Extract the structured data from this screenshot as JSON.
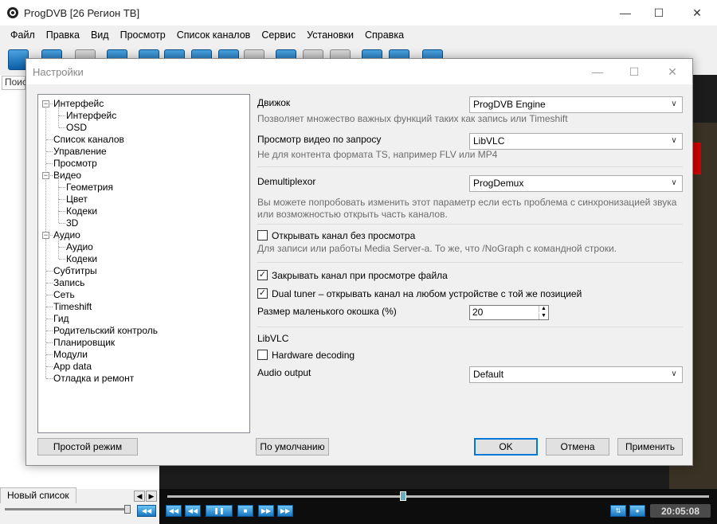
{
  "app": {
    "title": "ProgDVB [26 Регион ТВ]",
    "menu": [
      "Файл",
      "Правка",
      "Вид",
      "Просмотр",
      "Список каналов",
      "Сервис",
      "Установки",
      "Справка"
    ],
    "search_label": "Поис",
    "list_tab": "Новый список",
    "clock": "20:05:08"
  },
  "dialog": {
    "title": "Настройки",
    "tree": [
      {
        "label": "Интерфейс",
        "level": 0,
        "toggle": "-"
      },
      {
        "label": "Интерфейс",
        "level": 1
      },
      {
        "label": "OSD",
        "level": 1
      },
      {
        "label": "Список каналов",
        "level": 0
      },
      {
        "label": "Управление",
        "level": 0
      },
      {
        "label": "Просмотр",
        "level": 0
      },
      {
        "label": "Видео",
        "level": 0,
        "toggle": "-"
      },
      {
        "label": "Геометрия",
        "level": 1
      },
      {
        "label": "Цвет",
        "level": 1
      },
      {
        "label": "Кодеки",
        "level": 1
      },
      {
        "label": "3D",
        "level": 1
      },
      {
        "label": "Аудио",
        "level": 0,
        "toggle": "-"
      },
      {
        "label": "Аудио",
        "level": 1
      },
      {
        "label": "Кодеки",
        "level": 1
      },
      {
        "label": "Субтитры",
        "level": 0
      },
      {
        "label": "Запись",
        "level": 0
      },
      {
        "label": "Сеть",
        "level": 0
      },
      {
        "label": "Timeshift",
        "level": 0
      },
      {
        "label": "Гид",
        "level": 0
      },
      {
        "label": "Родительский контроль",
        "level": 0
      },
      {
        "label": "Планировщик",
        "level": 0
      },
      {
        "label": "Модули",
        "level": 0
      },
      {
        "label": "App data",
        "level": 0
      },
      {
        "label": "Отладка и ремонт",
        "level": 0
      }
    ],
    "engine": {
      "label": "Движок",
      "value": "ProgDVB Engine",
      "hint": "Позволяет множество важных функций таких как запись или Timeshift"
    },
    "on_demand": {
      "label": "Просмотр видео по запросу",
      "value": "LibVLC",
      "hint": "Не для контента формата TS, например FLV или MP4"
    },
    "demux": {
      "label": "Demultiplexor",
      "value": "ProgDemux",
      "hint1": "Вы можете попробовать изменить этот параметр если есть проблема с синхронизацией звука",
      "hint2": "или возможностью открыть часть каналов."
    },
    "open_no_view": {
      "label": "Открывать канал без просмотра",
      "checked": false,
      "hint": "Для записи или работы Media Server-а. То же, что /NoGraph с командной строки."
    },
    "close_on_file": {
      "label": "Закрывать канал при просмотре файла",
      "checked": true
    },
    "dual_tuner": {
      "label": "Dual tuner – открывать канал на любом устройстве с той же позицией",
      "checked": true
    },
    "small_window": {
      "label": "Размер маленького окошка (%)",
      "value": "20"
    },
    "libvlc": {
      "section": "LibVLC",
      "hw_decoding": {
        "label": "Hardware decoding",
        "checked": false
      },
      "audio_output_label": "Audio output",
      "audio_output_value": "Default"
    },
    "buttons": {
      "simple_mode": "Простой режим",
      "defaults": "По умолчанию",
      "ok": "OK",
      "cancel": "Отмена",
      "apply": "Применить"
    }
  },
  "colors": {
    "accent": "#0078d7",
    "toolbar_blue": "#1b7bc6",
    "hint_grey": "#6d6d6d"
  }
}
